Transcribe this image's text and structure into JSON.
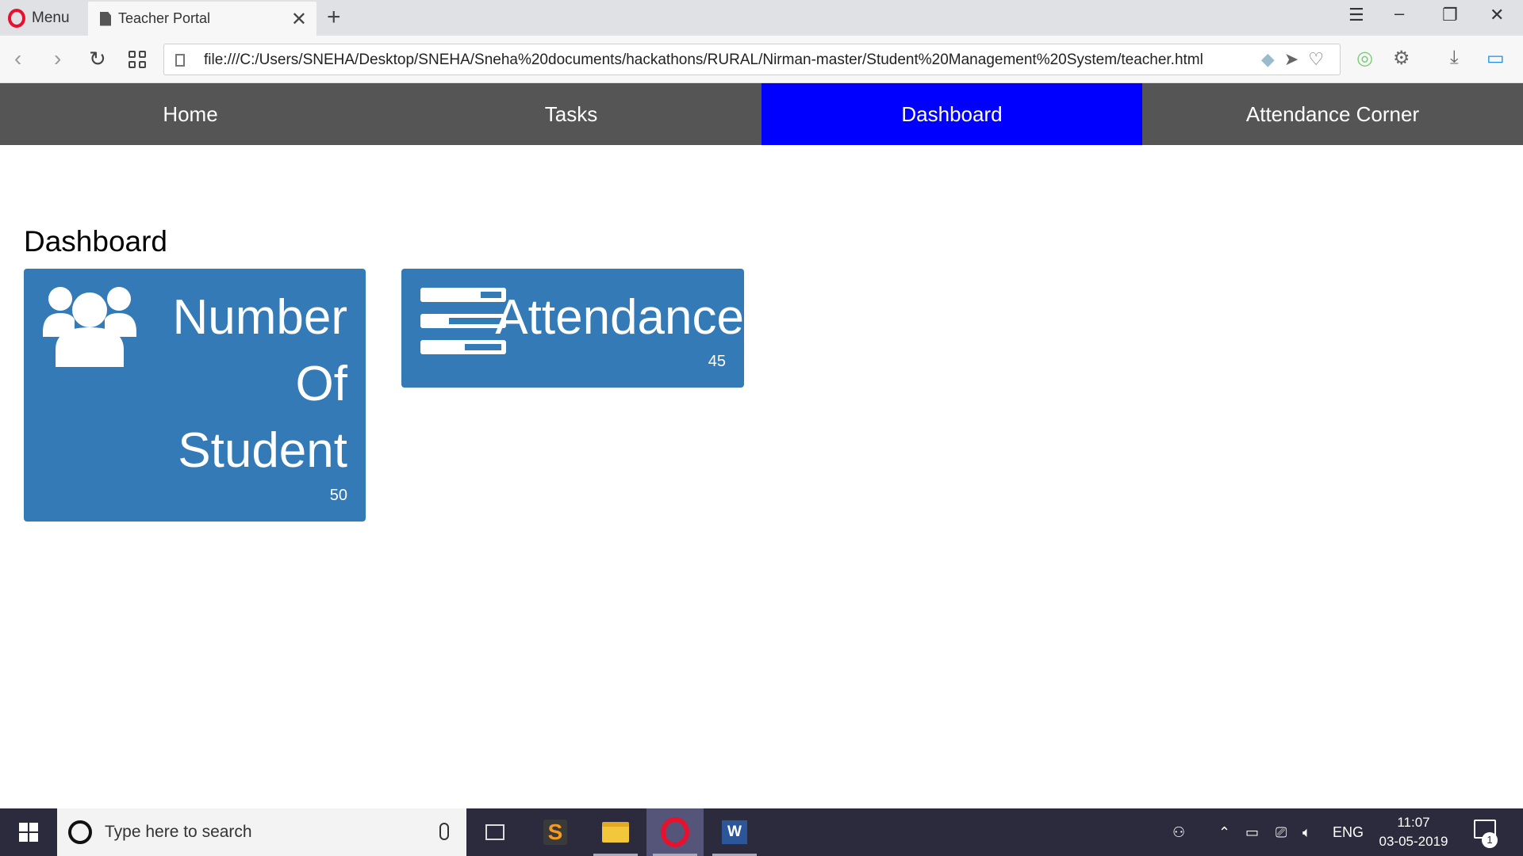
{
  "browser": {
    "menu_label": "Menu",
    "tab_title": "Teacher Portal",
    "new_tab_symbol": "+",
    "url": "file:///C:/Users/SNEHA/Desktop/SNEHA/Sneha%20documents/hackathons/RURAL/Nirman-master/Student%20Management%20System/teacher.html"
  },
  "nav": {
    "items": [
      {
        "label": "Home"
      },
      {
        "label": "Tasks"
      },
      {
        "label": "Dashboard"
      },
      {
        "label": "Attendance Corner"
      }
    ],
    "active_index": 2,
    "bar_color": "#555555",
    "active_color": "#0000ff"
  },
  "main": {
    "title": "Dashboard",
    "cards": [
      {
        "label_line1": "Number",
        "label_line2": "Of",
        "label_line3": "Student",
        "count": "50",
        "icon": "users-icon"
      },
      {
        "label": "Attendance",
        "count": "45",
        "icon": "tasks-icon"
      }
    ],
    "card_color": "#337ab7"
  },
  "taskbar": {
    "search_placeholder": "Type here to search",
    "language": "ENG",
    "time": "11:07",
    "date": "03-05-2019",
    "notification_count": "1"
  }
}
